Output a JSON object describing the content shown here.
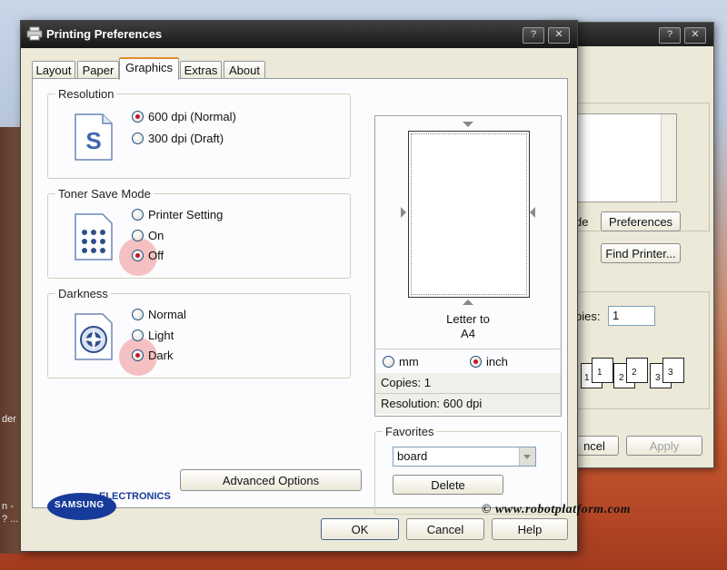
{
  "background": {
    "left_labels": [
      "der",
      "n -",
      "? ..."
    ]
  },
  "back_window": {
    "help_glyph": "?",
    "close_glyph": "✕",
    "partial_label": "de",
    "preferences_label": "Preferences",
    "find_printer_label": "Find Printer...",
    "copies_partial_label": "pies:",
    "copies_value": "1",
    "cancel_partial_label": "ncel",
    "apply_label": "Apply",
    "collate_numbers": [
      [
        "1",
        "1"
      ],
      [
        "2",
        "2"
      ],
      [
        "3",
        "3"
      ]
    ]
  },
  "dialog": {
    "title": "Printing Preferences",
    "help_glyph": "?",
    "close_glyph": "✕",
    "tabs": [
      "Layout",
      "Paper",
      "Graphics",
      "Extras",
      "About"
    ],
    "active_tab": "Graphics",
    "resolution": {
      "label": "Resolution",
      "options": [
        "600 dpi (Normal)",
        "300 dpi (Draft)"
      ],
      "selected": "600 dpi (Normal)"
    },
    "toner": {
      "label": "Toner Save Mode",
      "options": [
        "Printer Setting",
        "On",
        "Off"
      ],
      "selected": "Off"
    },
    "darkness": {
      "label": "Darkness",
      "options": [
        "Normal",
        "Light",
        "Dark"
      ],
      "selected": "Dark"
    },
    "preview": {
      "paper_line1": "Letter to",
      "paper_line2": "A4",
      "unit_mm": "mm",
      "unit_inch": "inch",
      "selected_unit": "inch",
      "copies": "Copies: 1",
      "resolution": "Resolution: 600 dpi"
    },
    "favorites": {
      "label": "Favorites",
      "value": "board",
      "delete_label": "Delete"
    },
    "advanced_label": "Advanced Options",
    "logo_top": "SAMSUNG",
    "logo_bottom": "ELECTRONICS",
    "ok_label": "OK",
    "cancel_label": "Cancel",
    "help_label": "Help"
  },
  "watermark": "© www.robotplatform.com",
  "colors": {
    "accent_tab": "#e68b2c",
    "radio_dot": "#c8142a",
    "logo_blue": "#173b9a"
  }
}
